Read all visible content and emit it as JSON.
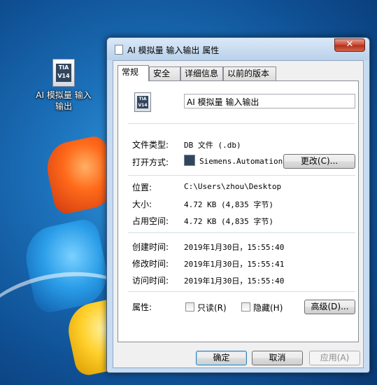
{
  "desktop": {
    "icon_label": "AI 模拟量 输入输出",
    "icon_badge": "TIA V14"
  },
  "window": {
    "title": "AI 模拟量 输入输出 属性",
    "close_glyph": "✕"
  },
  "tabs": [
    {
      "label": "常规",
      "active": true
    },
    {
      "label": "安全",
      "active": false
    },
    {
      "label": "详细信息",
      "active": false
    },
    {
      "label": "以前的版本",
      "active": false
    }
  ],
  "general": {
    "file_name": "AI 模拟量 输入输出",
    "file_type_label": "文件类型:",
    "file_type_value": "DB 文件 (.db)",
    "opens_with_label": "打开方式:",
    "opens_with_value": "Siemens.Automation.",
    "change_button": "更改(C)...",
    "location_label": "位置:",
    "location_value": "C:\\Users\\zhou\\Desktop",
    "size_label": "大小:",
    "size_value": "4.72 KB (4,835 字节)",
    "size_on_disk_label": "占用空间:",
    "size_on_disk_value": "4.72 KB (4,835 字节)",
    "created_label": "创建时间:",
    "created_value": "2019年1月30日，15:55:40",
    "modified_label": "修改时间:",
    "modified_value": "2019年1月30日，15:55:41",
    "accessed_label": "访问时间:",
    "accessed_value": "2019年1月30日，15:55:40",
    "attributes_label": "属性:",
    "readonly_label": "只读(R)",
    "readonly_checked": false,
    "hidden_label": "隐藏(H)",
    "hidden_checked": false,
    "advanced_button": "高级(D)..."
  },
  "footer": {
    "ok_button": "确定",
    "cancel_button": "取消",
    "apply_button": "应用(A)"
  }
}
